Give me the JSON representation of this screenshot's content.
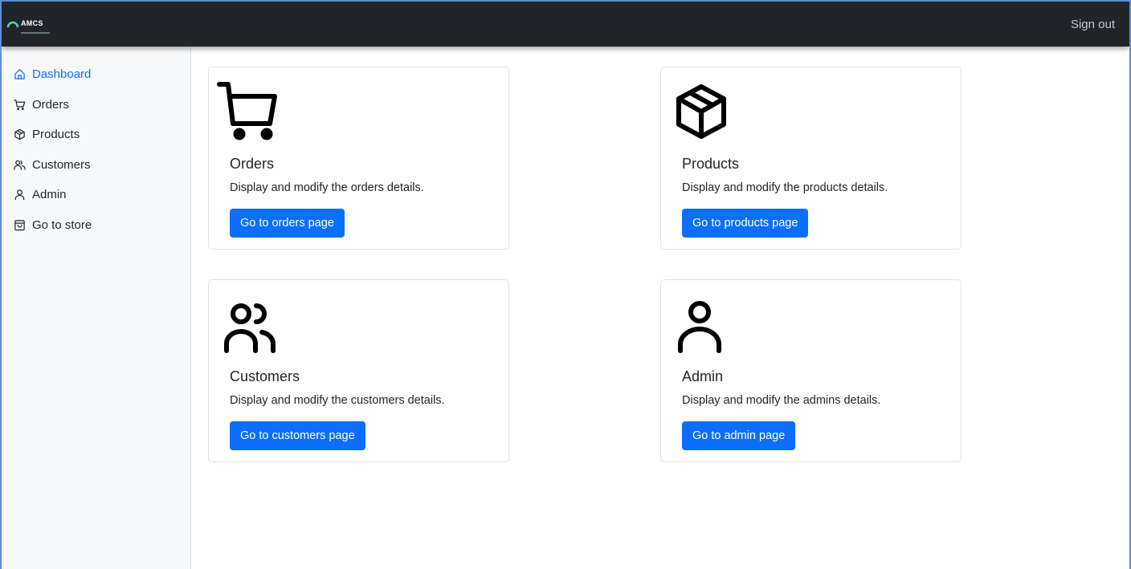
{
  "header": {
    "logo_text": "AMCS",
    "signout_label": "Sign out"
  },
  "sidebar": {
    "items": [
      {
        "label": "Dashboard",
        "icon": "house-icon",
        "active": true
      },
      {
        "label": "Orders",
        "icon": "cart-icon"
      },
      {
        "label": "Products",
        "icon": "box-icon"
      },
      {
        "label": "Customers",
        "icon": "people-icon"
      },
      {
        "label": "Admin",
        "icon": "person-icon"
      },
      {
        "label": "Go to store",
        "icon": "bag-icon"
      }
    ]
  },
  "cards": [
    {
      "title": "Orders",
      "text": "Display and modify the orders details.",
      "button": "Go to orders page",
      "icon": "cart-icon"
    },
    {
      "title": "Products",
      "text": "Display and modify the products details.",
      "button": "Go to products page",
      "icon": "box-icon"
    },
    {
      "title": "Customers",
      "text": "Display and modify the customers details.",
      "button": "Go to customers page",
      "icon": "people-icon"
    },
    {
      "title": "Admin",
      "text": "Display and modify the admins details.",
      "button": "Go to admin page",
      "icon": "person-icon"
    }
  ],
  "colors": {
    "accent": "#0d6efd",
    "topbar": "#212529",
    "sidebar_bg": "#f8f9fa"
  }
}
